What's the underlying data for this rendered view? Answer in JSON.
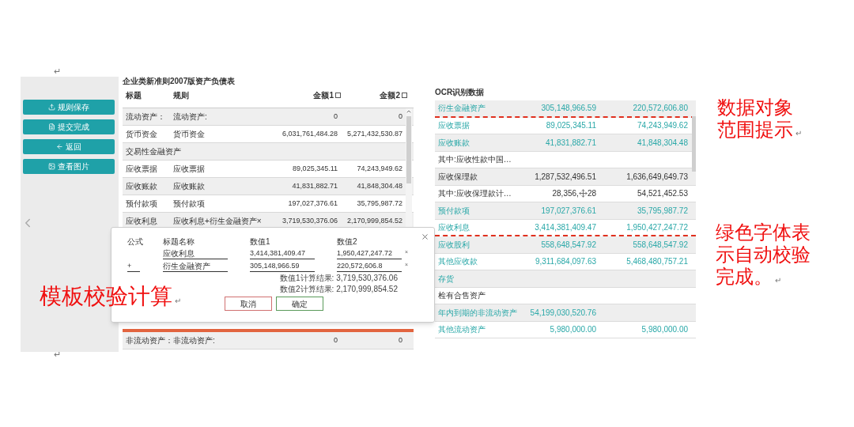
{
  "doc_marks": [
    "↵",
    "↵"
  ],
  "sidebar": {
    "buttons": [
      {
        "kind": "save",
        "label": "规则保存"
      },
      {
        "kind": "submit",
        "label": "提交完成"
      },
      {
        "kind": "back",
        "label": "返回"
      },
      {
        "kind": "image",
        "label": "查看图片"
      }
    ]
  },
  "template_table": {
    "title": "企业类新准则2007版资产负债表",
    "columns": [
      {
        "label": "标题"
      },
      {
        "label": "规则"
      },
      {
        "label": "金额1",
        "checked": false
      },
      {
        "label": "金额2",
        "checked": false
      }
    ],
    "rows": [
      {
        "title": "流动资产：",
        "rule": "流动资产:",
        "amount_1": "0",
        "amount_2": "0"
      },
      {
        "title": "货币资金",
        "rule": "货币资金",
        "amount_1": "6,031,761,484.28",
        "amount_2": "5,271,432,530.87"
      },
      {
        "title": "交易性金融资产",
        "rule": "",
        "amount_1": "",
        "amount_2": ""
      },
      {
        "title": "应收票据",
        "rule": "应收票据",
        "amount_1": "89,025,345.11",
        "amount_2": "74,243,949.62"
      },
      {
        "title": "应收账款",
        "rule": "应收账款",
        "amount_1": "41,831,882.71",
        "amount_2": "41,848,304.48"
      },
      {
        "title": "预付款项",
        "rule": "预付款项",
        "amount_1": "197,027,376.61",
        "amount_2": "35,795,987.72"
      },
      {
        "title": "应收利息",
        "rule": "应收利息+衍生金融资产×",
        "amount_1": "3,719,530,376.06",
        "amount_2": "2,170,999,854.52"
      }
    ],
    "rows_below": [
      {
        "title": "非流动资产：",
        "rule": "非流动资产:",
        "amount_1": "0",
        "amount_2": "0"
      }
    ]
  },
  "formula_dialog": {
    "columns": [
      "公式",
      "标题名称",
      "数值1",
      "数值2"
    ],
    "rows": [
      {
        "operator": "",
        "name": "应收利息",
        "value_1": "3,414,381,409.47",
        "value_2": "1,950,427,247.72",
        "remove": "×"
      },
      {
        "operator": "+",
        "name": "衍生金融资产",
        "value_1": "305,148,966.59",
        "value_2": "220,572,606.8",
        "remove": "×"
      }
    ],
    "results": [
      "数值1计算结果: 3,719,530,376.06",
      "数值2计算结果: 2,170,999,854.52"
    ],
    "cancel": "取消",
    "confirm": "确定"
  },
  "ocr_panel": {
    "title": "OCR识别数据",
    "rows": [
      {
        "name": "衍生金融资产",
        "value_1": "305,148,966.59",
        "value_2": "220,572,606.80",
        "verified": true,
        "range_end": true
      },
      {
        "name": "应收票据",
        "value_1": "89,025,345.11",
        "value_2": "74,243,949.62",
        "verified": true,
        "range_end": false
      },
      {
        "name": "应收账款",
        "value_1": "41,831,882.71",
        "value_2": "41,848,304.48",
        "verified": true,
        "range_end": false
      },
      {
        "name": "其中:应收性款中国…",
        "value_1": "",
        "value_2": "",
        "verified": false,
        "range_end": false
      },
      {
        "name": "应收保理款",
        "value_1": "1,287,532,496.51",
        "value_2": "1,636,649,649.73",
        "verified": false,
        "range_end": false
      },
      {
        "name": "其中:应收保理款计…",
        "value_1": "28,356,",
        "value_1_after": "28",
        "value_2": "54,521,452.53",
        "verified": false,
        "range_end": false
      },
      {
        "name": "预付款项",
        "value_1": "197,027,376.61",
        "value_2": "35,795,987.72",
        "verified": true,
        "range_end": false
      },
      {
        "name": "应收利息",
        "value_1": "3,414,381,409.47",
        "value_2": "1,950,427,247.72",
        "verified": true,
        "range_end": true
      },
      {
        "name": "应收股利",
        "value_1": "558,648,547.92",
        "value_2": "558,648,547.92",
        "verified": true,
        "range_end": false
      },
      {
        "name": "其他应收款",
        "value_1": "9,311,684,097.63",
        "value_2": "5,468,480,757.21",
        "verified": true,
        "range_end": false
      },
      {
        "name": "存货",
        "value_1": "",
        "value_2": "",
        "verified": true,
        "range_end": false
      },
      {
        "name": "检有合售资产",
        "value_1": "",
        "value_2": "",
        "verified": false,
        "range_end": false
      },
      {
        "name": "年内到期的非流动资产",
        "value_1": "54,199,030,520.76",
        "value_2": "",
        "verified": true,
        "range_end": false
      },
      {
        "name": "其他流动资产",
        "value_1": "5,980,000.00",
        "value_2": "5,980,000.00",
        "verified": true,
        "range_end": false
      }
    ]
  },
  "annotations": [
    {
      "kind": "range_hint",
      "text": "数据对象范围提示",
      "mark": "↵"
    },
    {
      "kind": "green_hint",
      "text": "绿色字体表示自动校验完成。",
      "mark": "↵"
    },
    {
      "kind": "calc",
      "text": "模板校验计算",
      "mark": "↵"
    }
  ]
}
